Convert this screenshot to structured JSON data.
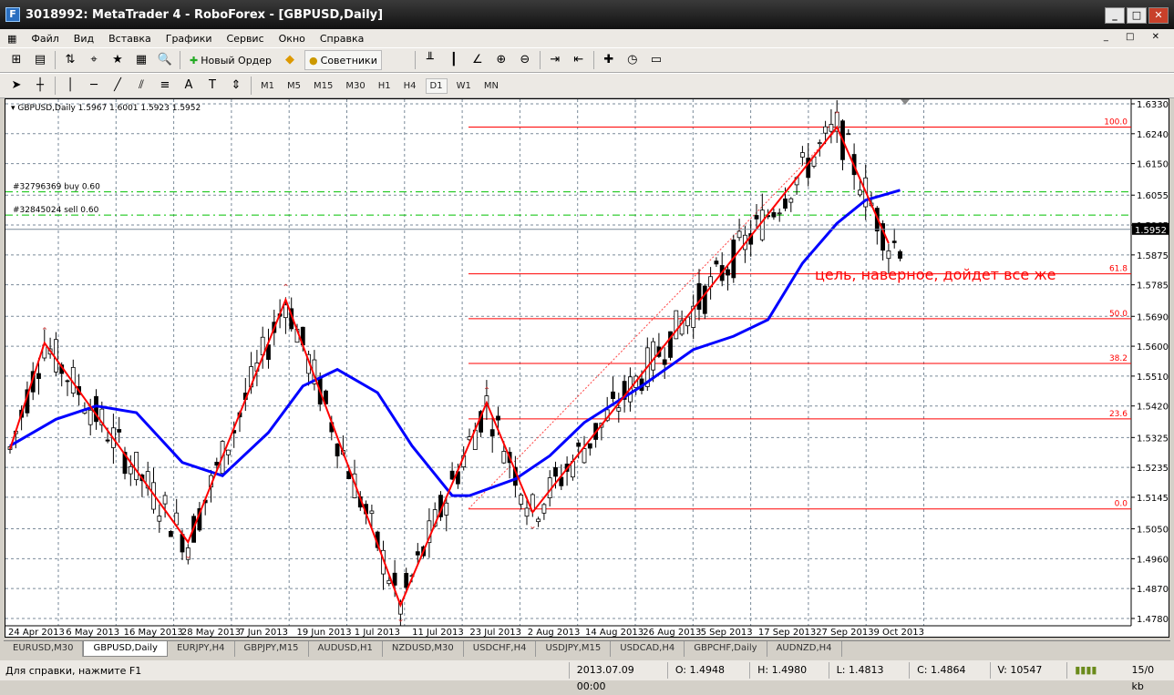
{
  "window": {
    "title": "3018992: MetaTrader 4 - RoboForex - [GBPUSD,Daily]"
  },
  "menu": [
    "Файл",
    "Вид",
    "Вставка",
    "Графики",
    "Сервис",
    "Окно",
    "Справка"
  ],
  "toolbar": {
    "new_order": "Новый Ордер",
    "experts": "Советники"
  },
  "timeframes": [
    "M1",
    "M5",
    "M15",
    "M30",
    "H1",
    "H4",
    "D1",
    "W1",
    "MN"
  ],
  "active_timeframe": "D1",
  "chart": {
    "header": "GBPUSD,Daily  1.5967 1.6001 1.5923 1.5952",
    "orders": [
      {
        "label": "#32796369 buy 0.60",
        "price": 1.6065
      },
      {
        "label": "#32845024 sell 0.60",
        "price": 1.5995
      }
    ],
    "current_price": "1.5952",
    "price_labels": [
      "1.6330",
      "1.6240",
      "1.6150",
      "1.6055",
      "1.5965",
      "1.5875",
      "1.5785",
      "1.5690",
      "1.5600",
      "1.5510",
      "1.5420",
      "1.5325",
      "1.5235",
      "1.5145",
      "1.5050",
      "1.4960",
      "1.4870",
      "1.4780"
    ],
    "date_labels": [
      "24 Apr 2013",
      "6 May 2013",
      "16 May 2013",
      "28 May 2013",
      "7 Jun 2013",
      "19 Jun 2013",
      "1 Jul 2013",
      "11 Jul 2013",
      "23 Jul 2013",
      "2 Aug 2013",
      "14 Aug 2013",
      "26 Aug 2013",
      "5 Sep 2013",
      "17 Sep 2013",
      "27 Sep 2013",
      "9 Oct 2013"
    ],
    "fib_levels": [
      {
        "label": "100.0",
        "price": 1.626
      },
      {
        "label": "61.8",
        "price": 1.5818
      },
      {
        "label": "50.0",
        "price": 1.5683
      },
      {
        "label": "38.2",
        "price": 1.5548
      },
      {
        "label": "23.6",
        "price": 1.5381
      },
      {
        "label": "0.0",
        "price": 1.511
      }
    ],
    "annotation": "цель, наверное, дойдет все же",
    "zigzag_bars": [
      [
        0,
        1.529
      ],
      [
        6,
        1.561
      ],
      [
        31,
        1.501
      ],
      [
        48,
        1.574
      ],
      [
        68,
        1.482
      ],
      [
        83,
        1.543
      ],
      [
        91,
        1.51
      ],
      [
        144,
        1.626
      ],
      [
        153,
        1.591
      ]
    ],
    "ma_bars": [
      [
        0,
        1.53
      ],
      [
        8,
        1.538
      ],
      [
        15,
        1.542
      ],
      [
        22,
        1.54
      ],
      [
        30,
        1.525
      ],
      [
        37,
        1.521
      ],
      [
        45,
        1.534
      ],
      [
        51,
        1.548
      ],
      [
        57,
        1.553
      ],
      [
        64,
        1.546
      ],
      [
        70,
        1.53
      ],
      [
        77,
        1.515
      ],
      [
        80,
        1.515
      ],
      [
        88,
        1.52
      ],
      [
        94,
        1.527
      ],
      [
        100,
        1.537
      ],
      [
        110,
        1.548
      ],
      [
        119,
        1.559
      ],
      [
        126,
        1.563
      ],
      [
        132,
        1.568
      ],
      [
        138,
        1.585
      ],
      [
        144,
        1.597
      ],
      [
        149,
        1.604
      ],
      [
        155,
        1.607
      ]
    ],
    "colors": {
      "zigzag": "#ff0000",
      "ma": "#0000ff",
      "fib": "#ff0000",
      "sell": "#00c000"
    }
  },
  "tabs": [
    "EURUSD,M30",
    "GBPUSD,Daily",
    "EURJPY,H4",
    "GBPJPY,M15",
    "AUDUSD,H1",
    "NZDUSD,M30",
    "USDCHF,H4",
    "USDJPY,M15",
    "USDCAD,H4",
    "GBPCHF,Daily",
    "AUDNZD,H4"
  ],
  "active_tab": "GBPUSD,Daily",
  "status": {
    "help": "Для справки, нажмите F1",
    "time": "2013.07.09 00:00",
    "open": "O: 1.4948",
    "high": "H: 1.4980",
    "low": "L: 1.4813",
    "close": "C: 1.4864",
    "volume": "V: 10547",
    "traffic": "15/0 kb"
  }
}
